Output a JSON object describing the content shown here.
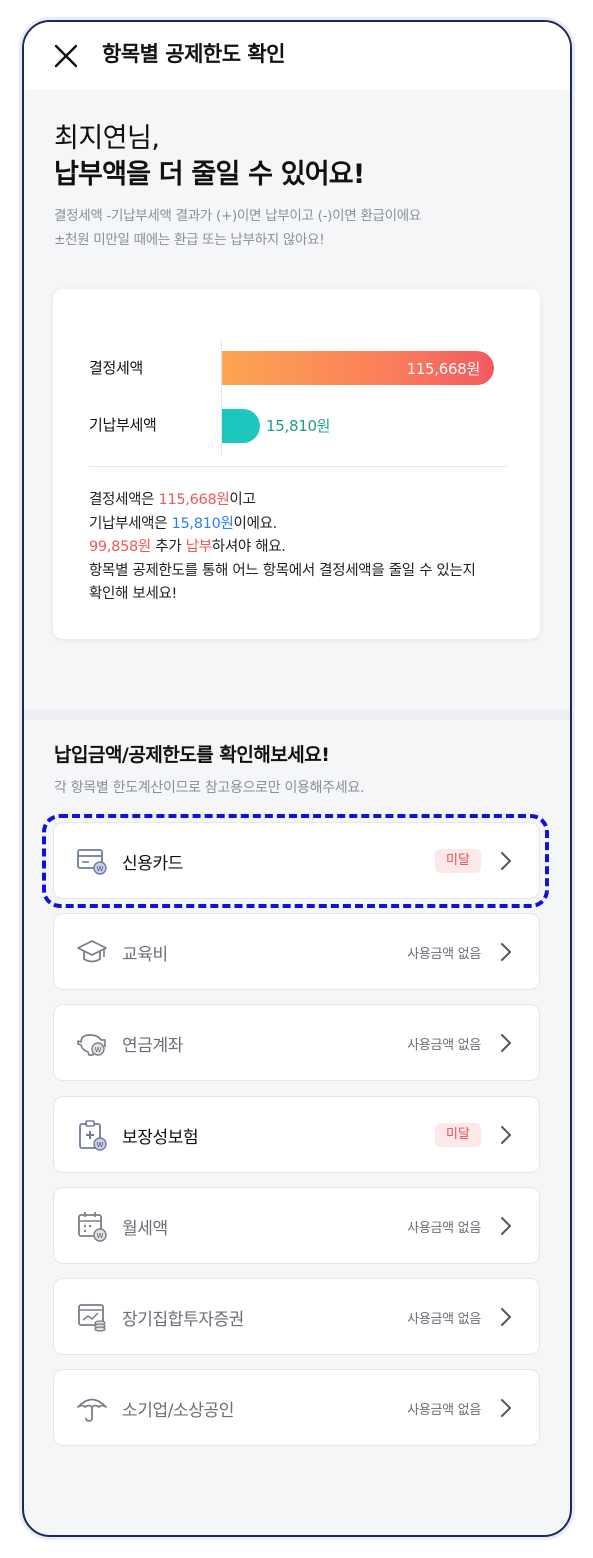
{
  "header": {
    "title": "항목별 공제한도 확인"
  },
  "greeting": {
    "line1": "최지연님,",
    "line2": "납부액을 더 줄일 수 있어요!"
  },
  "notice": {
    "line1": "결정세액 -기납부세액 결과가 (+)이면 납부이고 (-)이면 환급이에요",
    "line2": "±천원 미만일 때에는 환급 또는 납부하지 않아요!"
  },
  "summary": {
    "decided_label": "결정세액",
    "prepaid_label": "기납부세액",
    "decided_value": "115,668원",
    "prepaid_value": "15,810원",
    "desc": {
      "p1_pre": "결정세액은 ",
      "p1_val": "115,668원",
      "p1_post": "이고",
      "p2_pre": "기납부세액은 ",
      "p2_val": "15,810원",
      "p2_post": "이에요.",
      "p3_val": "99,858원",
      "p3_mid": " 추가 ",
      "p3_hl": "납부",
      "p3_post": "하셔야 해요.",
      "p4": "항목별 공제한도를 통해 어느 항목에서 결정세액을 줄일 수 있는지",
      "p5": "확인해 보세요!"
    }
  },
  "chart_data": {
    "type": "bar",
    "categories": [
      "결정세액",
      "기납부세액"
    ],
    "values": [
      115668
    ],
    "series": [
      {
        "values": [
          115668,
          15810
        ]
      }
    ],
    "colors": [
      "#fb7f5a",
      "#1cc8be"
    ]
  },
  "section": {
    "title": "납입금액/공제한도를 확인해보세요!",
    "subtitle": "각 항목별 한도계산이므로 참고용으로만 이용해주세요."
  },
  "items": [
    {
      "label": "신용카드",
      "status": "미달",
      "badge": true,
      "icon": "credit-card-icon"
    },
    {
      "label": "교육비",
      "status": "사용금액 없음",
      "badge": false,
      "icon": "graduation-cap-icon"
    },
    {
      "label": "연금계좌",
      "status": "사용금액 없음",
      "badge": false,
      "icon": "piggy-bank-icon"
    },
    {
      "label": "보장성보험",
      "status": "미달",
      "badge": true,
      "icon": "clipboard-medical-icon"
    },
    {
      "label": "월세액",
      "status": "사용금액 없음",
      "badge": false,
      "icon": "calendar-icon"
    },
    {
      "label": "장기집합투자증권",
      "status": "사용금액 없음",
      "badge": false,
      "icon": "investment-icon"
    },
    {
      "label": "소기업/소상공인",
      "status": "사용금액 없음",
      "badge": false,
      "icon": "umbrella-icon"
    }
  ]
}
